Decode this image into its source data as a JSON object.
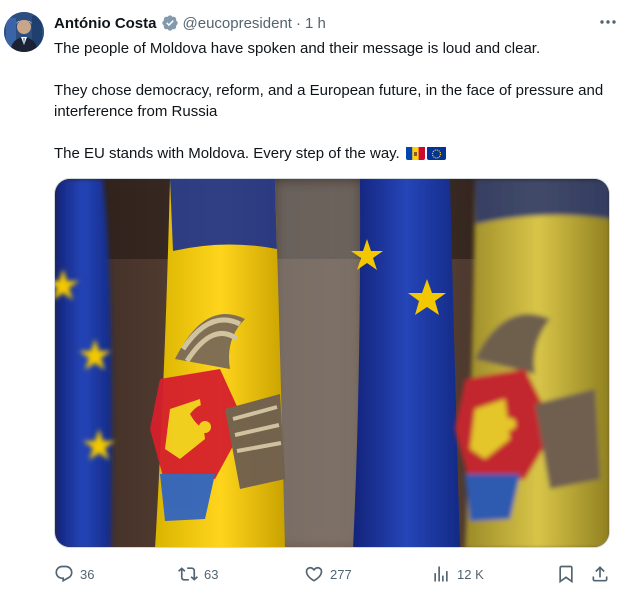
{
  "author": {
    "name": "António Costa",
    "handle": "@eucopresident",
    "separator": "·",
    "time": "1 h",
    "verified": true
  },
  "tweet": {
    "line1": "The people of Moldova have spoken and their message is loud and clear.",
    "line2": "They chose democracy, reform, and a European future, in the face of pressure and interference from Russia",
    "line3": "The EU stands with Moldova. Every step of the way.",
    "flags": [
      "moldova-flag",
      "eu-flag"
    ]
  },
  "media": {
    "description_icon": "photo"
  },
  "actions": {
    "replies": "36",
    "reposts": "63",
    "likes": "277",
    "views": "12 K"
  },
  "colors": {
    "text": "#0f1419",
    "muted": "#536471",
    "verified_badge": "#829aab",
    "moldova_blue": "#0046ae",
    "moldova_yellow": "#ffd200",
    "moldova_red": "#cc092f",
    "eu_blue": "#003399",
    "eu_star": "#ffcc00"
  }
}
